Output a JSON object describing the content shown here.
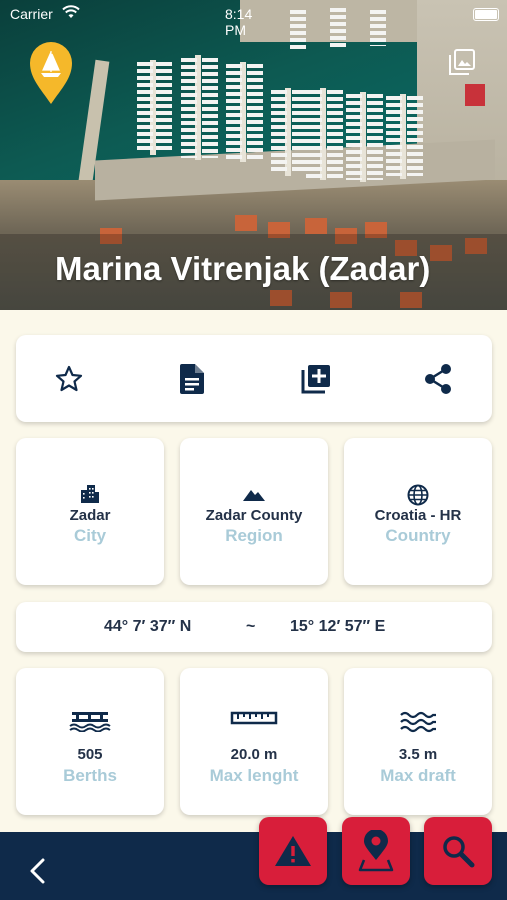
{
  "status_bar": {
    "carrier": "Carrier",
    "time": "8:14 PM"
  },
  "header": {
    "title": "Marina Vitrenjak (Zadar)"
  },
  "actions": [
    {
      "name": "favorite",
      "icon": "star-outline-icon"
    },
    {
      "name": "notes",
      "icon": "document-icon"
    },
    {
      "name": "add",
      "icon": "add-to-collection-icon"
    },
    {
      "name": "share",
      "icon": "share-icon"
    }
  ],
  "location": {
    "city": {
      "value": "Zadar",
      "label": "City",
      "icon": "city-icon"
    },
    "region": {
      "value": "Zadar County",
      "label": "Region",
      "icon": "mountain-icon"
    },
    "country": {
      "value": "Croatia - HR",
      "label": "Country",
      "icon": "globe-icon"
    }
  },
  "coordinates": {
    "lat": "44° 7′ 37″ N",
    "separator": "~",
    "lon": "15° 12′ 57″ E"
  },
  "stats": {
    "berths": {
      "value": "505",
      "label": "Berths",
      "icon": "berths-icon"
    },
    "length": {
      "value": "20.0 m",
      "label": "Max lenght",
      "icon": "ruler-icon"
    },
    "draft": {
      "value": "3.5 m",
      "label": "Max draft",
      "icon": "waves-icon"
    }
  },
  "colors": {
    "navy": "#0f2a4a",
    "accent_red": "#d81e3a",
    "label_blue": "#a9cbd8",
    "pin_yellow": "#f5b82a"
  }
}
